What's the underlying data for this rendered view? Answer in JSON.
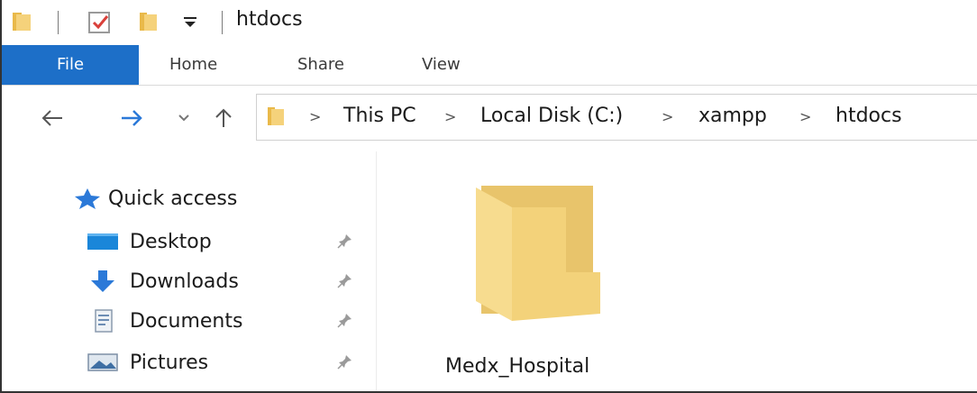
{
  "window": {
    "title": "htdocs"
  },
  "titlebar": {
    "icons": [
      "folder-icon",
      "properties-check-icon",
      "new-folder-icon",
      "customize-dropdown-icon"
    ]
  },
  "ribbon": {
    "tabs": [
      {
        "label": "File",
        "active": true
      },
      {
        "label": "Home"
      },
      {
        "label": "Share"
      },
      {
        "label": "View"
      }
    ]
  },
  "navigation": {
    "back_icon": "back-arrow-icon",
    "forward_icon": "forward-arrow-icon",
    "recent_icon": "chevron-down-icon",
    "up_icon": "up-arrow-icon"
  },
  "address_bar": {
    "crumbs": [
      "This PC",
      "Local Disk (C:)",
      "xampp",
      "htdocs"
    ],
    "separator": ">"
  },
  "nav_pane": {
    "quick_access": {
      "label": "Quick access",
      "icon": "star-icon"
    },
    "items": [
      {
        "label": "Desktop",
        "icon": "desktop-icon",
        "pinned": true
      },
      {
        "label": "Downloads",
        "icon": "download-icon",
        "pinned": true
      },
      {
        "label": "Documents",
        "icon": "documents-icon",
        "pinned": true
      },
      {
        "label": "Pictures",
        "icon": "pictures-icon",
        "pinned": true
      }
    ]
  },
  "content": {
    "items": [
      {
        "name": "Medx_Hospital",
        "type": "folder"
      }
    ]
  },
  "colors": {
    "accent": "#1d6fc8",
    "folder_yellow": "#f3d27a",
    "star_blue": "#2b79d8"
  }
}
